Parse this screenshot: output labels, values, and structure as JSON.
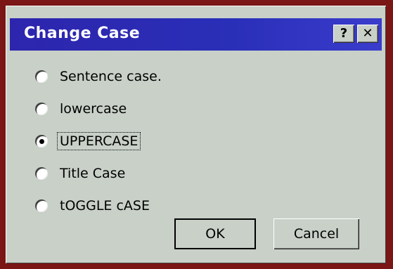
{
  "dialog": {
    "title": "Change Case",
    "help_label": "?",
    "close_label": "✕"
  },
  "options": [
    {
      "label": "Sentence case.",
      "checked": false
    },
    {
      "label": "lowercase",
      "checked": false
    },
    {
      "label": "UPPERCASE",
      "checked": true
    },
    {
      "label": "Title Case",
      "checked": false
    },
    {
      "label": "tOGGLE cASE",
      "checked": false
    }
  ],
  "buttons": {
    "ok_label": "OK",
    "cancel_label": "Cancel"
  },
  "colors": {
    "titlebar": "#2d25ad",
    "face": "#c8d0c8",
    "outer": "#7a1616"
  }
}
